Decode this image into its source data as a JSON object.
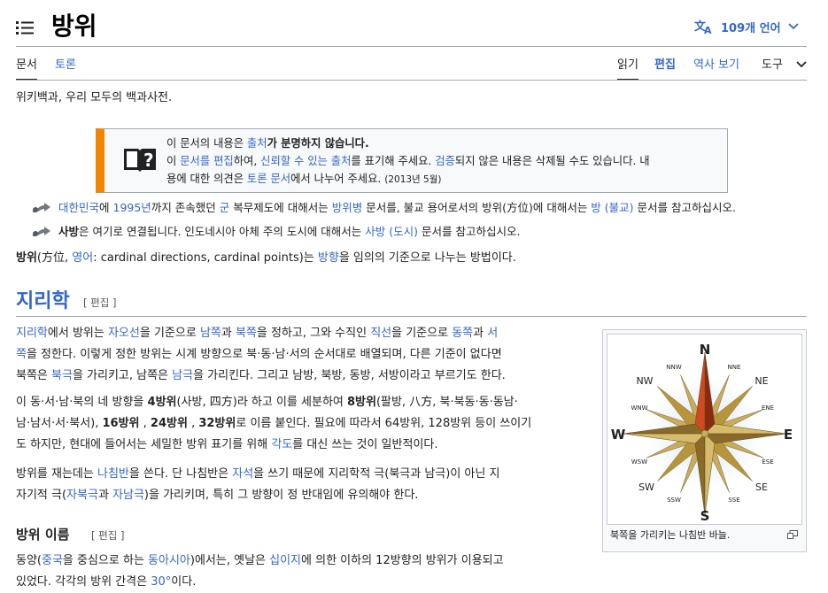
{
  "header": {
    "title": "방위",
    "languages_label": "109개 언어"
  },
  "tabs": {
    "article": "문서",
    "talk": "토론",
    "read": "읽기",
    "edit": "편집",
    "history": "역사 보기",
    "tools": "도구"
  },
  "tagline": "위키백과, 우리 모두의 백과사전.",
  "ambox": {
    "line1_a": "이 문서의 내용은 ",
    "line1_link": "출처",
    "line1_b": "가 분명하지 않습니다.",
    "line2_a": "이 ",
    "line2_link1": "문서를 편집",
    "line2_b": "하여, ",
    "line2_link2": "신뢰할 수 있는 출처",
    "line2_c": "를 표기해 주세요. ",
    "line2_link3": "검증",
    "line2_d": "되지 않은 내용은 삭제될 수도 있습니다. 내",
    "line3_a": "용에 대한 의견은 ",
    "line3_link": "토론 문서",
    "line3_b": "에서 나누어 주세요. ",
    "date": "(2013년 5월)"
  },
  "hatnotes": {
    "h1_link1": "대한민국",
    "h1_a": "에 ",
    "h1_link2": "1995년",
    "h1_b": "까지 존속했던 ",
    "h1_link3": "군",
    "h1_c": " 복무제도에 대해서는 ",
    "h1_link4": "방위병",
    "h1_d": " 문서를, 불교 용어로서의 방위(方位)에 대해서는 ",
    "h1_link5": "방 (불교)",
    "h1_e": " 문서를 참고하십시오.",
    "h2_bold": "사방",
    "h2_a": "은 여기로 연결됩니다. 인도네시아 아체 주의 도시에 대해서는 ",
    "h2_link": "사방 (도시)",
    "h2_b": " 문서를 참고하십시오."
  },
  "intro": {
    "bold": "방위",
    "a": "(方位, ",
    "link1": "영어",
    "b": ": cardinal directions, cardinal points)는 ",
    "link2": "방향",
    "c": "을 임의의 기준으로 나누는 방법이다."
  },
  "section": {
    "title": "지리학",
    "edit": "[ 편집 ]"
  },
  "p1": {
    "link1": "지리학",
    "a": "에서 방위는 ",
    "link2": "자오선",
    "b": "을 기준으로 ",
    "link3": "남쪽",
    "c": "과 ",
    "link4": "북쪽",
    "d": "을 정하고, 그와 수직인 ",
    "link5": "직선",
    "e": "을 기준으로 ",
    "link6": "동쪽",
    "f": "과 ",
    "link7": "서",
    "line2_link": "쪽",
    "line2": "을 정한다. 이렇게 정한 방위는 시계 방향으로 북·동·남·서의 순서대로 배열되며, 다른 기준이 없다면",
    "line3_a": "북쪽은 ",
    "line3_link1": "북극",
    "line3_b": "을 가리키고, 남쪽은 ",
    "line3_link2": "남극",
    "line3_c": "을 가리킨다. 그리고 남방, 북방, 동방, 서방이라고 부르기도 한다."
  },
  "p2": {
    "a": "이 동·서·남·북의 네 방향을 ",
    "b1": "4방위",
    "b": "(사방, 四方)라 하고 이를 세분하여 ",
    "b2": "8방위",
    "c": "(팔방, 八方, 북·북동·동·동남·",
    "line2_a": "남·남서·서·북서), ",
    "b3": "16방위",
    "line2_b": " , ",
    "b4": "24방위",
    "line2_c": " , ",
    "b5": "32방위",
    "line2_d": "로 이름 붙인다. 필요에 따라서 64방위, 128방위 등이 쓰이기",
    "line3_a": "도 하지만, 현대에 들어서는 세밀한 방위 표기를 위해 ",
    "line3_link": "각도",
    "line3_b": "를 대신 쓰는 것이 일반적이다."
  },
  "p3": {
    "a": "방위를 재는데는 ",
    "link1": "나침반",
    "b": "을 쓴다. 단 나침반은 ",
    "link2": "자석",
    "c": "을 쓰기 때문에 지리학적 극(북극과 남극)이 아닌 지",
    "line2_a": "자기적 극(",
    "line2_link1": "자북극",
    "line2_b": "과 ",
    "line2_link2": "자남극",
    "line2_c": ")을 가리키며, 특히 그 방향이 정 반대임에 유의해야 한다."
  },
  "subsection": {
    "title": "방위 이름",
    "edit": "[ 편집 ]"
  },
  "p4": {
    "a": "동양(",
    "link1": "중국",
    "b": "을 중심으로 하는 ",
    "link2": "동아시아",
    "c": ")에서는, 옛날은 ",
    "link3": "십이지",
    "d": "에 의한 이하의 12방향의 방위가 이용되고",
    "line2_a": "있었다. 각각의 방위 간격은 ",
    "line2_link": "30°",
    "line2_b": "이다."
  },
  "figure": {
    "caption": "북쪽을 가리키는 나침반 바늘.",
    "labels": {
      "N": "N",
      "S": "S",
      "E": "E",
      "W": "W",
      "NE": "NE",
      "NW": "NW",
      "SE": "SE",
      "SW": "SW",
      "NNE": "NNE",
      "NNW": "NNW",
      "ENE": "ENE",
      "ESE": "ESE",
      "WNW": "WNW",
      "WSW": "WSW",
      "SSE": "SSE",
      "SSW": "SSW"
    }
  },
  "colors": {
    "link": "#3366cc",
    "ambox_border": "#f28500",
    "rule": "#a2a9b1"
  }
}
